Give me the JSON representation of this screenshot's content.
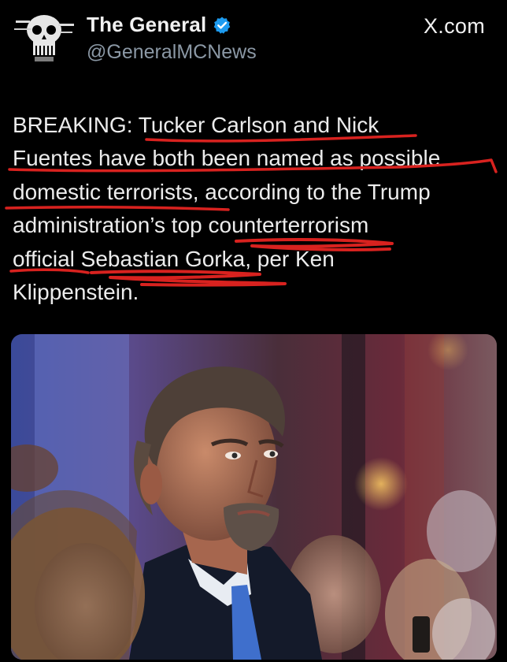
{
  "post": {
    "author": {
      "display_name": "The General",
      "handle": "@GeneralMCNews",
      "verified": true,
      "verified_icon": "verified-badge-icon",
      "avatar": "skull-logo-avatar"
    },
    "source_label": "X.com",
    "text_lines": [
      "BREAKING: Tucker Carlson and Nick",
      "Fuentes have both been named as possible",
      "domestic terrorists, according to the Trump",
      "administration’s top counterterrorism",
      "official Sebastian Gorka, per Ken",
      "Klippenstein."
    ],
    "annotation_color": "#d8221f",
    "photo": "photo-of-man-in-suit-at-event"
  },
  "colors": {
    "background": "#000000",
    "text": "#ececec",
    "muted": "#8b98a5",
    "verified_blue": "#1d9bf0"
  }
}
